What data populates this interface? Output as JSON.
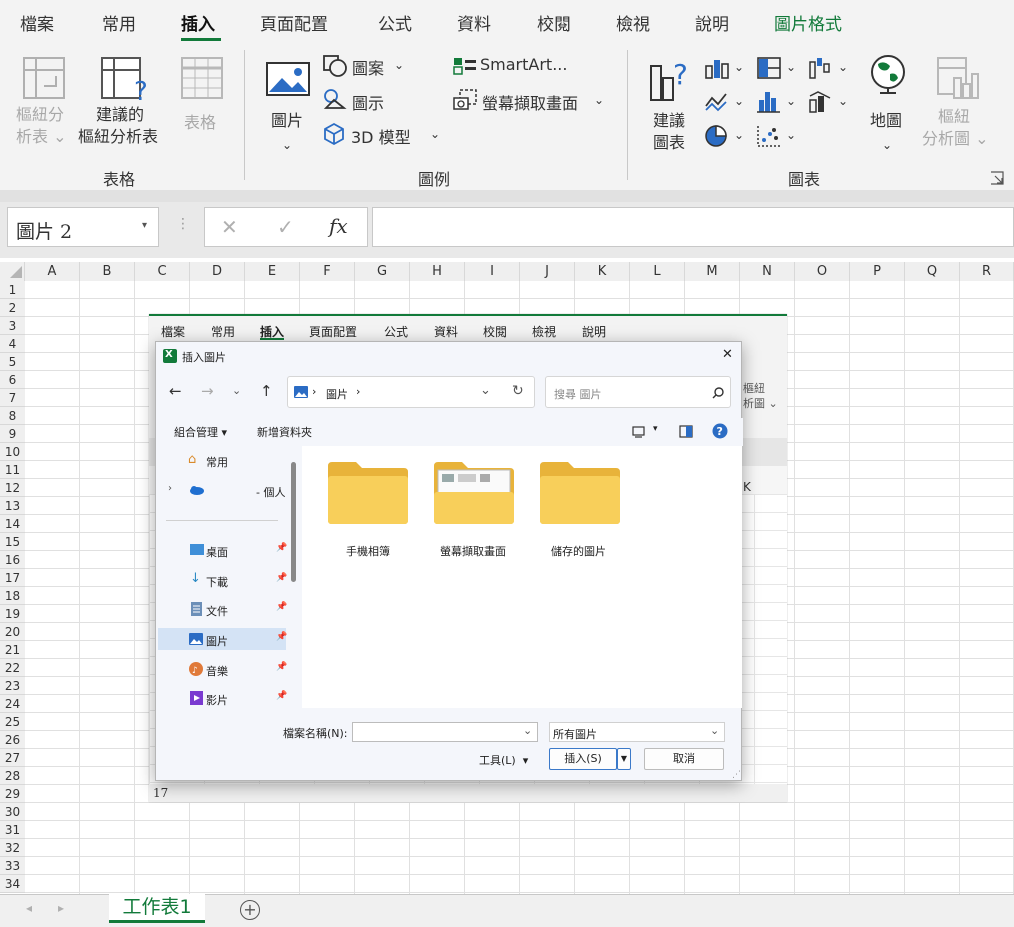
{
  "menu": {
    "tabs": [
      {
        "label": "檔案"
      },
      {
        "label": "常用"
      },
      {
        "label": "插入"
      },
      {
        "label": "頁面配置"
      },
      {
        "label": "公式"
      },
      {
        "label": "資料"
      },
      {
        "label": "校閱"
      },
      {
        "label": "檢視"
      },
      {
        "label": "說明"
      },
      {
        "label": "圖片格式"
      }
    ]
  },
  "ribbon": {
    "groups": {
      "tables": "表格",
      "illustrations": "圖例",
      "charts": "圖表"
    },
    "pivot_table": {
      "line1": "樞紐分",
      "line2": "析表"
    },
    "recommended_pivot": {
      "line1": "建議的",
      "line2": "樞紐分析表"
    },
    "table": "表格",
    "picture": "圖片",
    "shapes": "圖案",
    "icons": "圖示",
    "model3d": "3D 模型",
    "smartart": "SmartArt...",
    "screenshot": "螢幕擷取畫面",
    "recommended_charts": {
      "line1": "建議",
      "line2": "圖表"
    },
    "maps": "地圖",
    "pivot_chart": {
      "line1": "樞紐",
      "line2": "分析圖"
    }
  },
  "formula_bar": {
    "name_box": "圖片 2",
    "fx": "fx",
    "cancel": "✕",
    "enter": "✓",
    "value": ""
  },
  "grid": {
    "columns": [
      "A",
      "B",
      "C",
      "D",
      "E",
      "F",
      "G",
      "H",
      "I",
      "J",
      "K",
      "L",
      "M",
      "N",
      "O",
      "P",
      "Q",
      "R"
    ],
    "rows": [
      "1",
      "2",
      "3",
      "4",
      "5",
      "6",
      "7",
      "8",
      "9",
      "10",
      "11",
      "12",
      "13",
      "14",
      "15",
      "16",
      "17",
      "18",
      "19",
      "20",
      "21",
      "22",
      "23",
      "24",
      "25",
      "26",
      "27",
      "28",
      "29",
      "30",
      "31",
      "32",
      "33",
      "34"
    ]
  },
  "sheet_tabs": {
    "active": "工作表1",
    "add": "+"
  },
  "picture": {
    "menu_tabs": [
      {
        "label": "檔案"
      },
      {
        "label": "常用"
      },
      {
        "label": "插入"
      },
      {
        "label": "頁面配置"
      },
      {
        "label": "公式"
      },
      {
        "label": "資料"
      },
      {
        "label": "校閱"
      },
      {
        "label": "檢視"
      },
      {
        "label": "說明"
      }
    ],
    "ribbon_partial_1": "樞紐",
    "ribbon_partial_2": "析圖 ⌄",
    "col_k": "K",
    "row_17": "17"
  },
  "dialog": {
    "title": "插入圖片",
    "close": "✕",
    "address": {
      "segment1": "圖片",
      "sep": "›"
    },
    "search_placeholder": "搜尋 圖片",
    "toolbar": {
      "organize": "組合管理",
      "new_folder": "新增資料夾"
    },
    "sidebar": [
      {
        "label": "常用",
        "pinned": false
      },
      {
        "label": "- 個人",
        "pinned": false
      },
      {
        "label": "桌面",
        "pinned": true
      },
      {
        "label": "下載",
        "pinned": true
      },
      {
        "label": "文件",
        "pinned": true
      },
      {
        "label": "圖片",
        "pinned": true
      },
      {
        "label": "音樂",
        "pinned": true
      },
      {
        "label": "影片",
        "pinned": true
      }
    ],
    "folders": [
      {
        "label": "手機相簿"
      },
      {
        "label": "螢幕擷取畫面"
      },
      {
        "label": "儲存的圖片"
      }
    ],
    "footer": {
      "filename_label": "檔案名稱(N):",
      "filename_value": "",
      "filter": "所有圖片",
      "tools": "工具(L)",
      "insert": "插入(S)",
      "cancel": "取消"
    }
  }
}
